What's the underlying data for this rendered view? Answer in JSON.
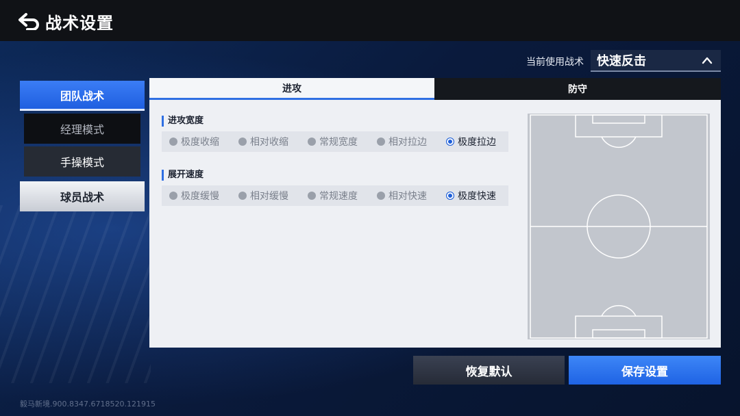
{
  "header": {
    "title": "战术设置",
    "back_icon": "back-arrow-icon"
  },
  "current_tactic": {
    "label": "当前使用战术",
    "value": "快速反击",
    "icon": "chevron-up-icon"
  },
  "sidebar": {
    "items": [
      {
        "label": "团队战术",
        "state": "active"
      },
      {
        "label": "经理模式",
        "state": "inactive"
      },
      {
        "label": "手操模式",
        "state": "inactive"
      },
      {
        "label": "球员战术",
        "state": "inactive"
      }
    ]
  },
  "tabs": [
    {
      "label": "进攻",
      "active": true
    },
    {
      "label": "防守",
      "active": false
    }
  ],
  "sections": [
    {
      "title": "进攻宽度",
      "options": [
        "极度收缩",
        "相对收缩",
        "常规宽度",
        "相对拉边",
        "极度拉边"
      ],
      "selected": 4
    },
    {
      "title": "展开速度",
      "options": [
        "极度缓慢",
        "相对缓慢",
        "常规速度",
        "相对快速",
        "极度快速"
      ],
      "selected": 4
    }
  ],
  "buttons": {
    "reset": "恢复默认",
    "save": "保存设置"
  },
  "watermark": "毅马新境.900.8347.6718520.121915",
  "colors": {
    "accent": "#2f6fe3",
    "selected_radio": "#1e5fd8",
    "pitch": "#c2c6cd"
  }
}
